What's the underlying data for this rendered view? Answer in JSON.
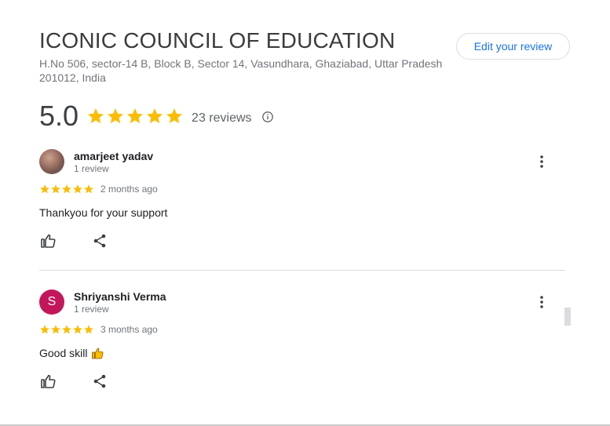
{
  "place": {
    "title": "ICONIC COUNCIL OF EDUCATION",
    "address": "H.No 506, sector-14 B, Block B, Sector 14, Vasundhara, Ghaziabad, Uttar Pradesh 201012, India"
  },
  "edit_button_label": "Edit your review",
  "summary": {
    "rating": "5.0",
    "stars": 5,
    "reviews_count": "23 reviews",
    "info_icon": "info-icon"
  },
  "reviews": [
    {
      "name": "amarjeet yadav",
      "reviews_label": "1 review",
      "stars": 5,
      "time": "2 months ago",
      "text": "Thankyou for your support",
      "avatar": "photo"
    },
    {
      "name": "Shriyanshi Verma",
      "avatar_letter": "S",
      "reviews_label": "1 review",
      "stars": 5,
      "time": "3 months ago",
      "text": "Good skill",
      "emoji": "thumbs-up"
    }
  ],
  "colors": {
    "star": "#fbbc04",
    "accent": "#1a73e8",
    "avatar_s": "#c2185b"
  }
}
